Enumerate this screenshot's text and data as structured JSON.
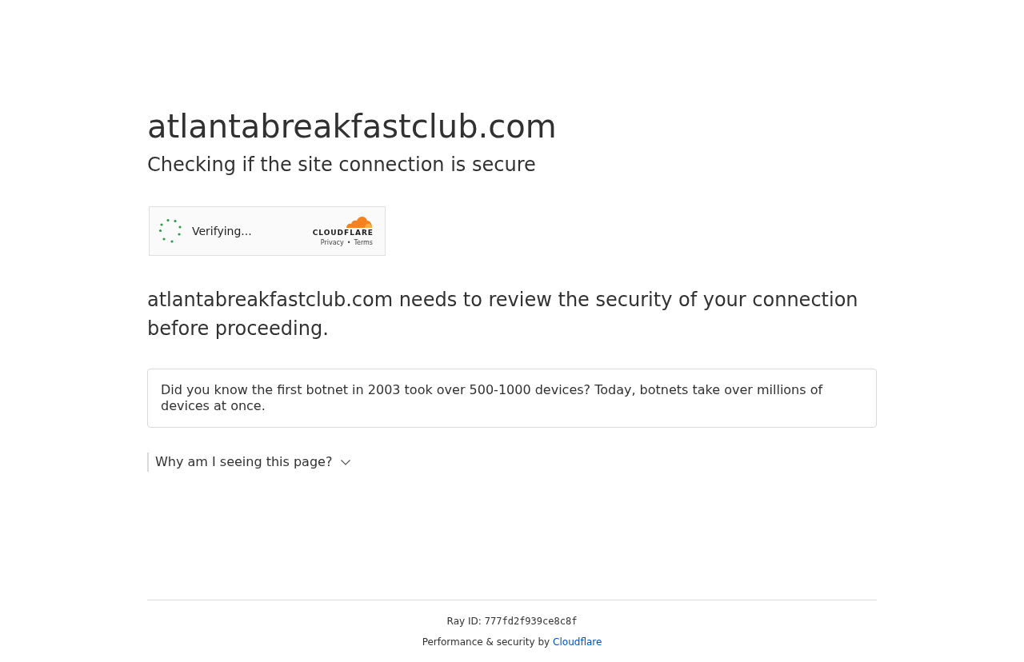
{
  "title": "atlantabreakfastclub.com",
  "subtitle": "Checking if the site connection is secure",
  "challenge_widget": {
    "status": "Verifying...",
    "logo_text": "CLOUDFLARE",
    "links": [
      "Privacy",
      "Terms"
    ],
    "separator": "•"
  },
  "message": "atlantabreakfastclub.com needs to review the security of your connection before proceeding.",
  "fact": "Did you know the first botnet in 2003 took over 500-1000 devices? Today, botnets take over millions of devices at once.",
  "disclosure": {
    "label": "Why am I seeing this page?",
    "expanded": false
  },
  "footer": {
    "ray_id_label": "Ray ID:",
    "ray_id": "777fd2f939ce8c8f",
    "performance_label": "Performance & security by",
    "provider_link": "Cloudflare"
  }
}
